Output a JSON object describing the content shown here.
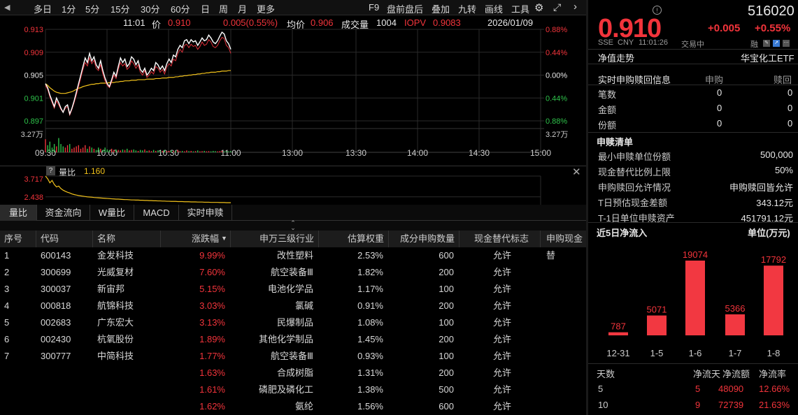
{
  "topbar": {
    "items": [
      "多日",
      "1分",
      "5分",
      "15分",
      "30分",
      "60分",
      "日",
      "周",
      "月",
      "更多"
    ],
    "active": "1分",
    "right_items": [
      "F9",
      "盘前盘后",
      "叠加",
      "九转",
      "画线",
      "工具"
    ]
  },
  "info": {
    "time": "11:01",
    "price_label": "价",
    "price": "0.910",
    "change": "0.005(0.55%)",
    "avg_label": "均价",
    "avg": "0.906",
    "vol_label": "成交量",
    "vol": "1004",
    "iopv_label": "IOPV",
    "iopv": "0.9083",
    "date": "2026/01/09"
  },
  "chart": {
    "y_left": [
      "0.913",
      "0.909",
      "0.905",
      "0.901",
      "0.897"
    ],
    "y_right": [
      "0.88%",
      "0.44%",
      "0.00%",
      "0.44%",
      "0.88%"
    ],
    "vol_label": "3.27万",
    "x_labels": [
      "09:30",
      "10:00",
      "10:30",
      "11:00",
      "13:00",
      "13:30",
      "14:00",
      "14:30",
      "15:00"
    ],
    "price": [
      0.9035,
      0.9028,
      0.9015,
      0.9005,
      0.8995,
      0.901,
      0.9002,
      0.8992,
      0.8985,
      0.8995,
      0.8998,
      0.8982,
      0.8992,
      0.9005,
      0.902,
      0.9035,
      0.905,
      0.9065,
      0.908,
      0.9072,
      0.9088,
      0.9075,
      0.9082,
      0.9068,
      0.9062,
      0.9075,
      0.9058,
      0.9045,
      0.9035,
      0.903,
      0.9042,
      0.9055,
      0.9048,
      0.9065,
      0.908,
      0.9072,
      0.9078,
      0.9065,
      0.907,
      0.9082,
      0.9078,
      0.9068,
      0.9075,
      0.906,
      0.9055,
      0.9062,
      0.905,
      0.9055,
      0.9062,
      0.9058,
      0.9072,
      0.9068,
      0.906,
      0.9066,
      0.9058,
      0.907,
      0.9078,
      0.9072,
      0.9085,
      0.9082,
      0.9095,
      0.9102,
      0.9098,
      0.911,
      0.9112,
      0.9105,
      0.9112,
      0.9108,
      0.911,
      0.9102,
      0.9108,
      0.9115,
      0.911,
      0.9112,
      0.912,
      0.9115,
      0.9108,
      0.9105,
      0.911,
      0.9118,
      0.9125,
      0.9122,
      0.911,
      0.9105,
      0.9095
    ],
    "avg": [
      0.9035,
      0.9032,
      0.9028,
      0.9025,
      0.9022,
      0.902,
      0.9019,
      0.9018,
      0.9018,
      0.9018,
      0.9019,
      0.902,
      0.9021,
      0.9023,
      0.9025,
      0.9027,
      0.9028,
      0.903,
      0.9031,
      0.9032,
      0.9033,
      0.9034,
      0.9034,
      0.9035,
      0.9035,
      0.9036,
      0.9036,
      0.9036,
      0.9036,
      0.9037,
      0.9037,
      0.9037,
      0.9038,
      0.9038,
      0.9039,
      0.9039,
      0.904,
      0.904,
      0.904,
      0.9041,
      0.9041,
      0.9041,
      0.9042,
      0.9042,
      0.9042,
      0.9042,
      0.9043,
      0.9043,
      0.9043,
      0.9043,
      0.9044,
      0.9044,
      0.9044,
      0.9045,
      0.9045,
      0.9045,
      0.9046,
      0.9046,
      0.9046,
      0.9047,
      0.9047,
      0.9048,
      0.9048,
      0.9049,
      0.9049,
      0.905,
      0.905,
      0.9051,
      0.9051,
      0.9052,
      0.9052,
      0.9053,
      0.9053,
      0.9054,
      0.9054,
      0.9055,
      0.9055,
      0.9055,
      0.9056,
      0.9056,
      0.9057,
      0.9057,
      0.9057,
      0.9058,
      0.9058
    ],
    "iopv": [
      0.9032,
      0.9025,
      0.9012,
      0.9002,
      0.8992,
      0.9005,
      0.8998,
      0.899,
      0.8985,
      0.8992,
      0.8995,
      0.898,
      0.899,
      0.9002,
      0.9015,
      0.903,
      0.9045,
      0.906,
      0.9072,
      0.9066,
      0.908,
      0.907,
      0.9076,
      0.9062,
      0.9058,
      0.9068,
      0.9052,
      0.904,
      0.9032,
      0.9028,
      0.9038,
      0.905,
      0.9044,
      0.906,
      0.9072,
      0.9066,
      0.907,
      0.906,
      0.9064,
      0.9075,
      0.907,
      0.9062,
      0.9068,
      0.9055,
      0.905,
      0.9058,
      0.9046,
      0.905,
      0.9056,
      0.9052,
      0.9065,
      0.9062,
      0.9055,
      0.906,
      0.9052,
      0.9064,
      0.907,
      0.9066,
      0.9078,
      0.9075,
      0.9088,
      0.9095,
      0.909,
      0.9102,
      0.9104,
      0.9098,
      0.9104,
      0.91,
      0.9102,
      0.9095,
      0.91,
      0.9108,
      0.9102,
      0.9104,
      0.9112,
      0.9108,
      0.91,
      0.9098,
      0.9102,
      0.911,
      0.9116,
      0.9114,
      0.9102,
      0.9098,
      0.9088
    ],
    "volume": [
      0.55,
      0.3,
      0.45,
      0.2,
      0.35,
      0.25,
      0.6,
      0.35,
      0.25,
      0.2,
      0.3,
      0.35,
      0.15,
      0.2,
      0.25,
      0.3,
      0.15,
      0.2,
      0.3,
      0.15,
      0.25,
      0.2,
      0.15,
      0.1,
      0.2,
      0.15,
      0.1,
      0.2,
      0.12,
      0.08,
      0.15,
      0.1,
      0.12,
      0.1,
      0.08,
      0.12,
      0.1,
      0.15,
      0.08,
      0.1,
      0.12,
      0.08,
      0.06,
      0.1,
      0.08,
      0.12,
      0.06,
      0.08,
      0.05,
      0.1,
      0.06,
      0.08,
      0.05,
      0.06,
      0.1,
      0.05,
      0.06,
      0.08,
      0.05,
      0.06,
      0.1,
      0.05,
      0.06,
      0.04,
      0.08,
      0.05,
      0.06,
      0.04,
      0.05,
      0.08,
      0.04,
      0.05,
      0.06,
      0.04,
      0.05,
      0.04,
      0.06,
      0.05,
      0.04,
      0.05,
      0.06,
      0.04,
      0.05,
      0.04,
      0.05
    ]
  },
  "volratio": {
    "help": "?",
    "label": "量比",
    "value": "1.160",
    "y_labels": [
      "3.717",
      "2.438"
    ],
    "values": [
      3.717,
      3.55,
      3.3,
      3.45,
      3.2,
      3.05,
      3.1,
      2.95,
      2.85,
      2.78,
      2.72,
      2.68,
      2.62,
      2.58,
      2.55,
      2.52,
      2.5,
      2.48,
      2.46,
      2.44,
      2.43,
      2.42,
      2.4,
      2.39,
      2.38,
      2.37,
      2.36,
      2.35,
      2.34,
      2.33,
      2.32,
      2.31,
      2.3,
      2.3,
      2.29,
      2.28,
      2.27,
      2.27,
      2.26,
      2.25,
      2.25,
      2.24,
      2.24,
      2.23,
      2.23,
      2.22,
      2.22,
      2.21,
      2.21,
      2.2,
      2.2,
      2.19,
      2.19,
      2.18,
      2.18,
      2.17,
      2.17,
      2.16,
      2.16,
      2.16,
      2.15,
      2.15,
      2.15,
      2.14,
      2.14,
      2.14,
      2.13,
      2.13,
      2.13,
      2.12,
      2.12,
      2.12,
      2.11,
      2.11,
      2.11,
      2.1,
      2.1,
      2.1,
      2.1,
      2.09,
      2.09,
      2.09,
      2.08,
      2.08,
      2.08
    ]
  },
  "tabs": [
    "量比",
    "资金流向",
    "W量比",
    "MACD",
    "实时申赎"
  ],
  "table": {
    "headers": [
      "序号",
      "代码",
      "名称",
      "涨跌幅",
      "申万三级行业",
      "估算权重",
      "成分申购数量",
      "现金替代标志",
      "申购现金替"
    ],
    "rows": [
      [
        "1",
        "600143",
        "金发科技",
        "9.99%",
        "改性塑料",
        "2.53%",
        "600",
        "允许"
      ],
      [
        "2",
        "300699",
        "光威复材",
        "7.60%",
        "航空装备Ⅲ",
        "1.82%",
        "200",
        "允许"
      ],
      [
        "3",
        "300037",
        "新宙邦",
        "5.15%",
        "电池化学品",
        "1.17%",
        "100",
        "允许"
      ],
      [
        "4",
        "000818",
        "航锦科技",
        "3.03%",
        "氯碱",
        "0.91%",
        "200",
        "允许"
      ],
      [
        "5",
        "002683",
        "广东宏大",
        "3.13%",
        "民爆制品",
        "1.08%",
        "100",
        "允许"
      ],
      [
        "6",
        "002430",
        "杭氧股份",
        "1.89%",
        "其他化学制品",
        "1.45%",
        "200",
        "允许"
      ],
      [
        "7",
        "300777",
        "中简科技",
        "1.77%",
        "航空装备Ⅲ",
        "0.93%",
        "100",
        "允许"
      ],
      [
        "",
        "",
        "",
        "1.63%",
        "合成树脂",
        "1.31%",
        "200",
        "允许"
      ],
      [
        "",
        "",
        "",
        "1.61%",
        "磷肥及磷化工",
        "1.38%",
        "500",
        "允许"
      ],
      [
        "",
        "",
        "",
        "1.62%",
        "氨纶",
        "1.56%",
        "600",
        "允许"
      ]
    ]
  },
  "right": {
    "code": "516020",
    "price": "0.910",
    "change": "+0.005",
    "pct": "+0.55%",
    "exch": "SSE",
    "cur": "CNY",
    "time": "11:01:26",
    "status": "交易中",
    "margin": "融",
    "nav_label": "净值走势",
    "etf_name": "华宝化工ETF",
    "sub_title": "实时申购赎回信息",
    "col_sub": "申购",
    "col_red": "赎回",
    "sub_rows": [
      [
        "笔数",
        "0",
        "0"
      ],
      [
        "金额",
        "0",
        "0"
      ],
      [
        "份额",
        "0",
        "0"
      ]
    ],
    "list_title": "申赎清单",
    "list_rows": [
      [
        "最小申赎单位份额",
        "500,000"
      ],
      [
        "现金替代比例上限",
        "50%"
      ],
      [
        "申购赎回允许情况",
        "申购赎回皆允许"
      ],
      [
        "T日预估现金差额",
        "343.12元"
      ],
      [
        "T-1日单位申赎资产",
        "451791.12元"
      ]
    ],
    "flow_title": "近5日净流入",
    "flow_unit": "单位(万元)",
    "flow": {
      "categories": [
        "12-31",
        "1-5",
        "1-6",
        "1-7",
        "1-8"
      ],
      "values": [
        787,
        5071,
        19074,
        5366,
        17792
      ]
    },
    "stat_headers": [
      "天数",
      "净流天",
      "净流额",
      "净流率"
    ],
    "stat_rows": [
      [
        "5",
        "5",
        "48090",
        "12.66%"
      ],
      [
        "10",
        "9",
        "72739",
        "21.63%"
      ]
    ]
  },
  "colors": {
    "red": "#f2343b",
    "green": "#2ec14a",
    "yellow": "#f2c21b",
    "bar": "#f23841"
  }
}
